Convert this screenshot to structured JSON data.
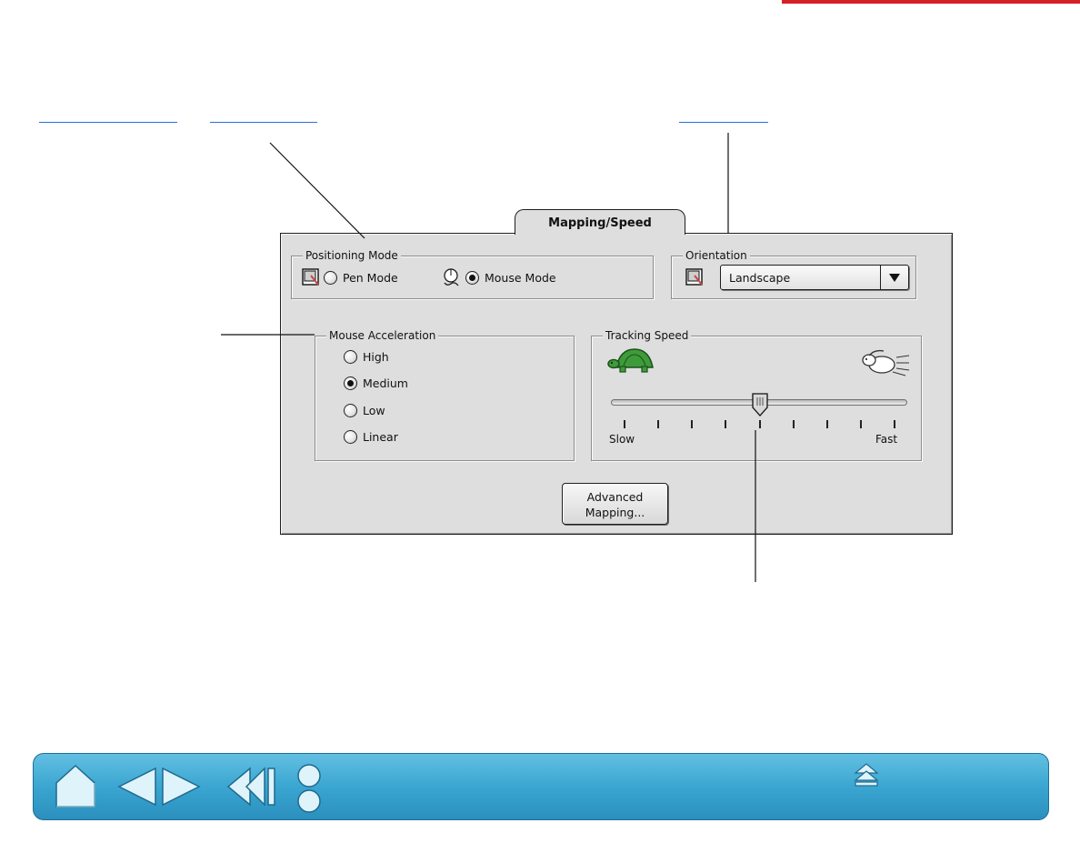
{
  "dialog": {
    "tab_label": "Mapping/Speed",
    "positioning_mode": {
      "title": "Positioning Mode",
      "pen_mode_label": "Pen Mode",
      "mouse_mode_label": "Mouse Mode",
      "selected": "Mouse Mode"
    },
    "orientation": {
      "title": "Orientation",
      "selected": "Landscape"
    },
    "mouse_acceleration": {
      "title": "Mouse Acceleration",
      "options": [
        "High",
        "Medium",
        "Low",
        "Linear"
      ],
      "selected": "Medium"
    },
    "tracking_speed": {
      "title": "Tracking Speed",
      "min_label": "Slow",
      "max_label": "Fast",
      "tick_count": 9,
      "value_fraction": 0.5
    },
    "advanced_button": {
      "line1": "Advanced",
      "line2": "Mapping..."
    }
  },
  "nav": {
    "icons": [
      "home-icon",
      "previous-page-icon",
      "next-page-icon",
      "back-icon",
      "index-icon",
      "eject-up-icon"
    ]
  },
  "colors": {
    "accent_red": "#d62027",
    "link_blue": "#2a6fd6",
    "nav_bar": "#3aa6d1",
    "panel_bg": "#dedede",
    "turtle_green": "#3e9b3a"
  }
}
